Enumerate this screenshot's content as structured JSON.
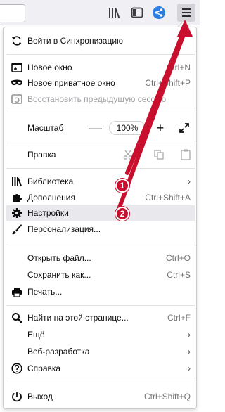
{
  "colors": {
    "accent_red": "#c8102e",
    "share_blue": "#2a7de1"
  },
  "toolbar": {
    "icons": [
      "library-icon",
      "sidebar-icon",
      "share-icon",
      "hamburger-menu-icon"
    ]
  },
  "menu": {
    "sync": {
      "label": "Войти в Синхронизацию"
    },
    "new_window": {
      "label": "Новое окно",
      "shortcut": "Ctrl+N"
    },
    "private_window": {
      "label": "Новое приватное окно",
      "shortcut": "Ctrl+Shift+P"
    },
    "restore_session": {
      "label": "Восстановить предыдущую сессию"
    },
    "zoom": {
      "label": "Масштаб",
      "minus": "—",
      "value": "100%",
      "plus": "+"
    },
    "edit": {
      "label": "Правка"
    },
    "library": {
      "label": "Библиотека",
      "chevron": "›"
    },
    "addons": {
      "label": "Дополнения",
      "shortcut": "Ctrl+Shift+A"
    },
    "settings": {
      "label": "Настройки"
    },
    "customize": {
      "label": "Персонализация..."
    },
    "open_file": {
      "label": "Открыть файл...",
      "shortcut": "Ctrl+O"
    },
    "save_as": {
      "label": "Сохранить как...",
      "shortcut": "Ctrl+S"
    },
    "print": {
      "label": "Печать..."
    },
    "find": {
      "label": "Найти на этой странице...",
      "shortcut": "Ctrl+F"
    },
    "more": {
      "label": "Ещё",
      "chevron": "›"
    },
    "web_dev": {
      "label": "Веб-разработка",
      "chevron": "›"
    },
    "help": {
      "label": "Справка",
      "chevron": "›"
    },
    "quit": {
      "label": "Выход",
      "shortcut": "Ctrl+Shift+Q"
    }
  },
  "annotations": {
    "badge1": "1",
    "badge2": "2"
  }
}
